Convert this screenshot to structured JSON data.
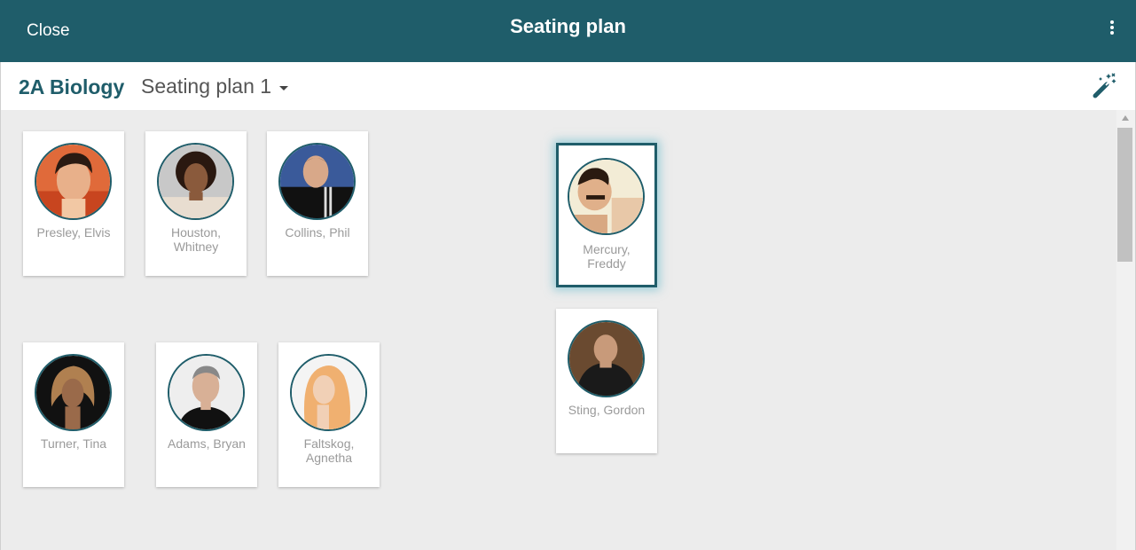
{
  "header": {
    "close_label": "Close",
    "title": "Seating plan",
    "more_icon": "more-vertical-icon",
    "bar_color": "#1f5d6a"
  },
  "toolbar": {
    "class_name": "2A Biology",
    "plan_name": "Seating plan 1",
    "dropdown_icon": "caret-down-icon",
    "auto_arrange_icon": "magic-wand-icon"
  },
  "students": [
    {
      "name": "Presley, Elvis"
    },
    {
      "name": "Houston, Whitney"
    },
    {
      "name": "Collins, Phil"
    },
    {
      "name": "Mercury, Freddy",
      "selected": true
    },
    {
      "name": "Turner, Tina"
    },
    {
      "name": "Adams, Bryan"
    },
    {
      "name": "Faltskog, Agnetha"
    },
    {
      "name": "Sting, Gordon"
    }
  ]
}
